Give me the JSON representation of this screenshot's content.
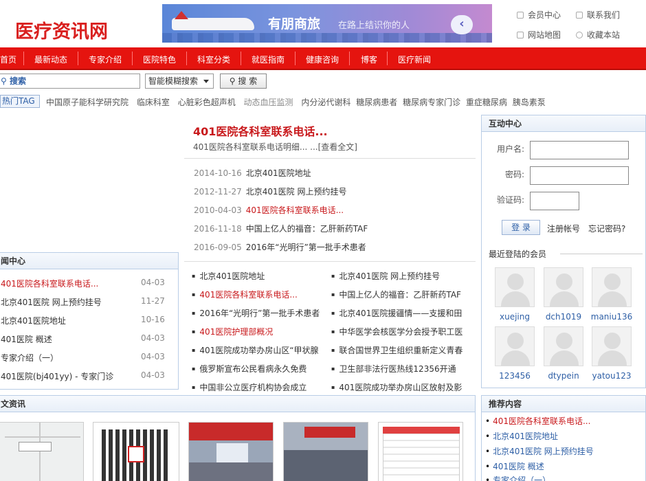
{
  "header": {
    "logo": "医疗资讯网",
    "banner": {
      "title": "有朋商旅",
      "subtitle": "在路上结识你的人"
    },
    "links": [
      "会员中心",
      "联系我们",
      "网站地图",
      "收藏本站"
    ]
  },
  "nav": [
    "首页",
    "最新动态",
    "专家介绍",
    "医院特色",
    "科室分类",
    "就医指南",
    "健康咨询",
    "博客",
    "医疗新闻"
  ],
  "search": {
    "placeholder": "搜索",
    "mode": "智能模糊搜索",
    "button": "搜 索"
  },
  "tags": {
    "label": "热门TAG",
    "items": [
      "中国原子能科学研究院",
      "临床科室",
      "心脏彩色超声机",
      "动态血压监测",
      "内分泌代谢科",
      "糖尿病患者",
      "糖尿病专家门诊",
      "重症糖尿病",
      "胰岛素泵"
    ]
  },
  "headline": {
    "title": "401医院各科室联系电话...",
    "desc": "401医院各科室联系电话明细... ...[查看全文]"
  },
  "dated_news": [
    {
      "date": "2014-10-16",
      "title": "北京401医院地址"
    },
    {
      "date": "2012-11-27",
      "title": "北京401医院 网上预约挂号"
    },
    {
      "date": "2010-04-03",
      "title": "401医院各科室联系电话..."
    },
    {
      "date": "2016-11-18",
      "title": "中国上亿人的福音：乙肝新药TAF"
    },
    {
      "date": "2016-09-05",
      "title": "2016年“光明行”第一批手术患者"
    }
  ],
  "bullet_left": [
    "北京401医院地址",
    "401医院各科室联系电话...",
    "2016年“光明行”第一批手术患者",
    "401医院护理部概况",
    "401医院成功举办房山区“甲状腺",
    "俄罗斯宣布公民看病永久免费",
    "中国非公立医疗机构协会成立"
  ],
  "bullet_right": [
    "北京401医院 网上预约挂号",
    "中国上亿人的福音：乙肝新药TAF",
    "北京401医院援疆情——支援和田",
    "中华医学会核医学分会授予职工医",
    "联合国世界卫生组织重新定义青春",
    "卫生部非法行医热线12356开通",
    "401医院成功举办房山区放射及影"
  ],
  "news_center": {
    "title": "闻中心",
    "rows": [
      {
        "title": "401医院各科室联系电话...",
        "date": "04-03"
      },
      {
        "title": "北京401医院 网上预约挂号",
        "date": "11-27"
      },
      {
        "title": "北京401医院地址",
        "date": "10-16"
      },
      {
        "title": "401医院 概述",
        "date": "04-03"
      },
      {
        "title": "专家介绍（一）",
        "date": "04-03"
      },
      {
        "title": "401医院(bj401yy) - 专家门诊",
        "date": "04-03"
      }
    ]
  },
  "interact": {
    "title": "互动中心",
    "username_label": "用户名:",
    "password_label": "密码:",
    "captcha_label": "验证码:",
    "login": "登 录",
    "register": "注册帐号",
    "forgot": "忘记密码?",
    "members_title": "最近登陆的会员",
    "members": [
      "xuejing",
      "dch1019",
      "maniu136",
      "123456",
      "dtypein",
      "yatou123"
    ]
  },
  "photo_news": {
    "title": "文资讯"
  },
  "recommend": {
    "title": "推荐内容",
    "items": [
      "401医院各科室联系电话...",
      "北京401医院地址",
      "北京401医院 网上预约挂号",
      "401医院 概述",
      "专家介绍（一）"
    ]
  }
}
